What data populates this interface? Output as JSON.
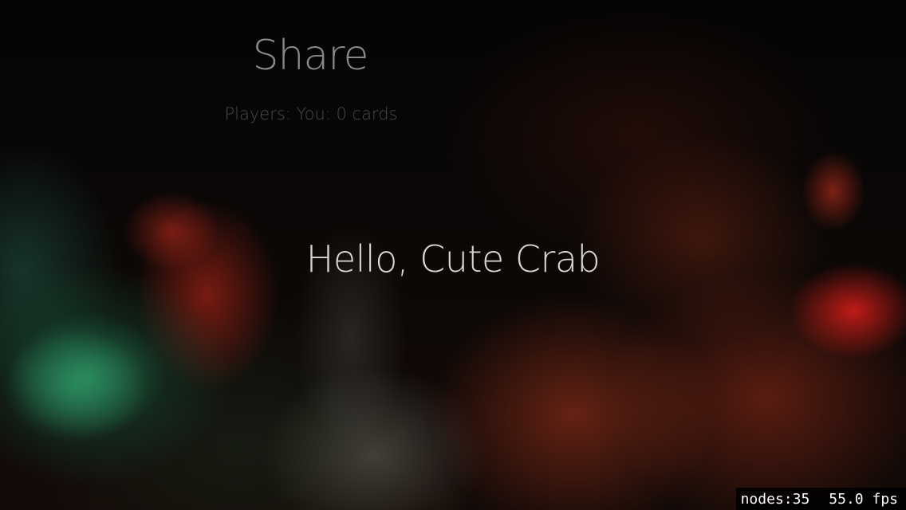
{
  "menu": {
    "title": "Share",
    "players_text": "Players: You: 0 cards"
  },
  "greeting": "Hello, Cute Crab",
  "debug": {
    "nodes": "nodes:35",
    "fps": "55.0 fps"
  }
}
